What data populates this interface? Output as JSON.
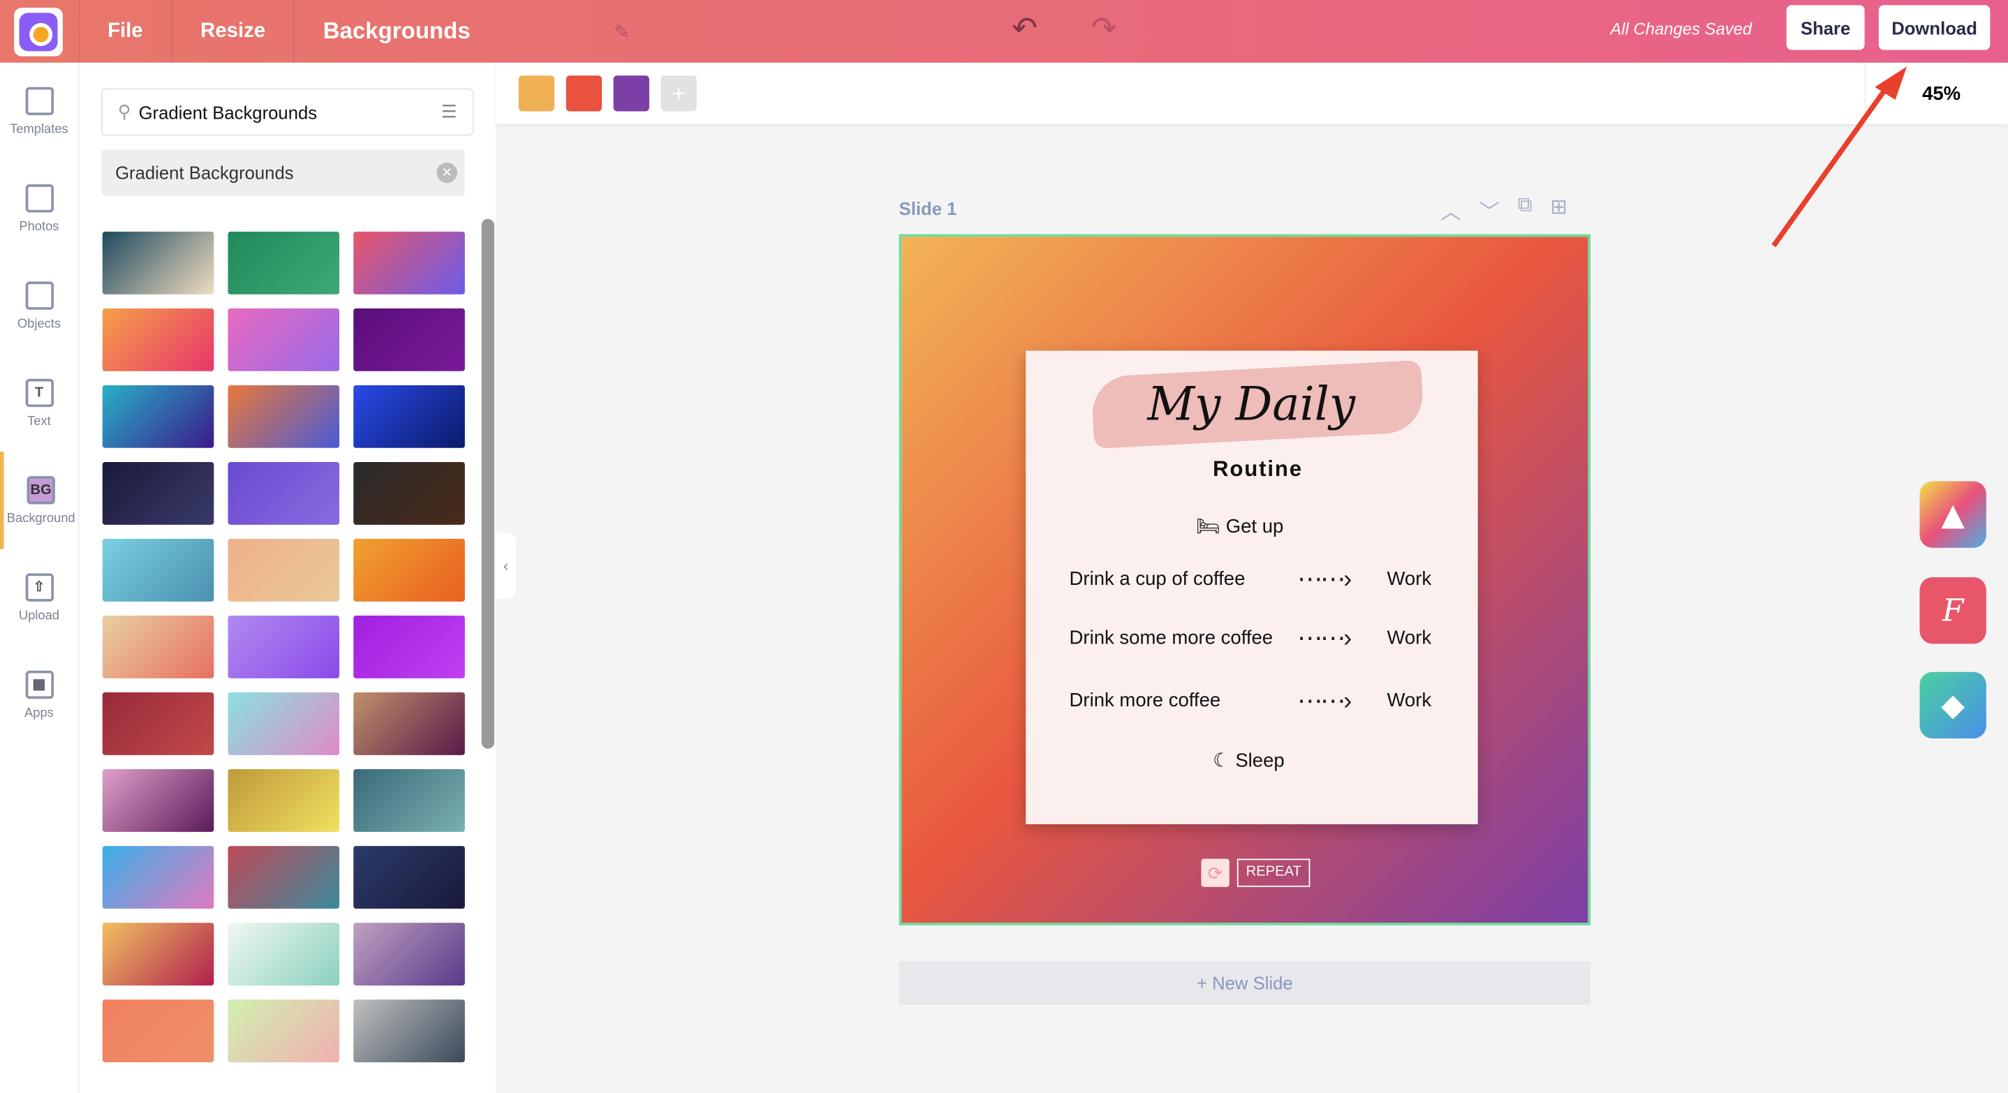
{
  "header": {
    "menu": [
      "File",
      "Resize",
      "Backgrounds"
    ],
    "status": "All Changes Saved",
    "share": "Share",
    "download": "Download"
  },
  "rail": [
    {
      "label": "Templates",
      "icon": "templates-icon"
    },
    {
      "label": "Photos",
      "icon": "photo-icon"
    },
    {
      "label": "Objects",
      "icon": "cup-icon"
    },
    {
      "label": "Text",
      "icon": "text-icon",
      "glyph": "T"
    },
    {
      "label": "Background",
      "icon": "bg-icon",
      "glyph": "BG",
      "active": true
    },
    {
      "label": "Upload",
      "icon": "upload-icon",
      "glyph": "⇧"
    },
    {
      "label": "Apps",
      "icon": "apps-icon",
      "glyph": "▦"
    }
  ],
  "panel": {
    "search_value": "Gradient Backgrounds",
    "chip": "Gradient Backgrounds",
    "swatches": [
      [
        "#1e4a5e",
        "#f0dcc0"
      ],
      [
        "#1f8a5a",
        "#3fa877"
      ],
      [
        "#e8566a",
        "#6b5ce8"
      ],
      [
        "#f5a04a",
        "#e8366a"
      ],
      [
        "#e86ac0",
        "#9a6ae8"
      ],
      [
        "#5a0e7a",
        "#7a1a9a"
      ],
      [
        "#2ab0c8",
        "#3a1a8a"
      ],
      [
        "#e8783a",
        "#4a5ad8"
      ],
      [
        "#2a4ae8",
        "#0a1a6a"
      ],
      [
        "#1a1a3a",
        "#3a3a6a"
      ],
      [
        "#6a4ad0",
        "#8a6ae0"
      ],
      [
        "#2a2a2a",
        "#4a2a1a"
      ],
      [
        "#7ad0e0",
        "#4a90b0"
      ],
      [
        "#f0b08a",
        "#e8c89a"
      ],
      [
        "#f0a030",
        "#e86020"
      ],
      [
        "#e8d0a0",
        "#e87060"
      ],
      [
        "#b08af0",
        "#8a4ae8"
      ],
      [
        "#a020e0",
        "#c040f0"
      ],
      [
        "#9a2a3a",
        "#c04a4a"
      ],
      [
        "#8ae0e0",
        "#e08ac8"
      ],
      [
        "#c0906a",
        "#5a1a4a"
      ],
      [
        "#e0a0c8",
        "#5a1a5a"
      ],
      [
        "#c09a3a",
        "#f0e060"
      ],
      [
        "#3a6a7a",
        "#7ab0b0"
      ],
      [
        "#3ab0e8",
        "#e07ac0"
      ],
      [
        "#c04a5a",
        "#3a8a9a"
      ],
      [
        "#2a3a6a",
        "#1a1a3a"
      ],
      [
        "#f0c060",
        "#b02050"
      ],
      [
        "#f0f8f0",
        "#8ad0c0"
      ],
      [
        "#c0a0c0",
        "#5a3a8a"
      ],
      [
        "#f08060",
        "#f0906a"
      ],
      [
        "#d0f0b0",
        "#f0b0b0"
      ],
      [
        "#c0c0c0",
        "#3a4a5a"
      ]
    ]
  },
  "toolbar": {
    "colors": [
      "#f0b054",
      "#e9523f",
      "#7b3fa6"
    ],
    "zoom": "45%"
  },
  "slide": {
    "label": "Slide 1",
    "title": "My Daily",
    "subtitle": "Routine",
    "get_up": "Get up",
    "rows": [
      {
        "left": "Drink a cup of coffee",
        "right": "Work"
      },
      {
        "left": "Drink some more coffee",
        "right": "Work"
      },
      {
        "left": "Drink more coffee",
        "right": "Work"
      }
    ],
    "sleep": "Sleep",
    "repeat": "REPEAT"
  },
  "new_slide": "+ New Slide",
  "annotation": {
    "arrow_color": "#e8402a",
    "target": "Download"
  }
}
